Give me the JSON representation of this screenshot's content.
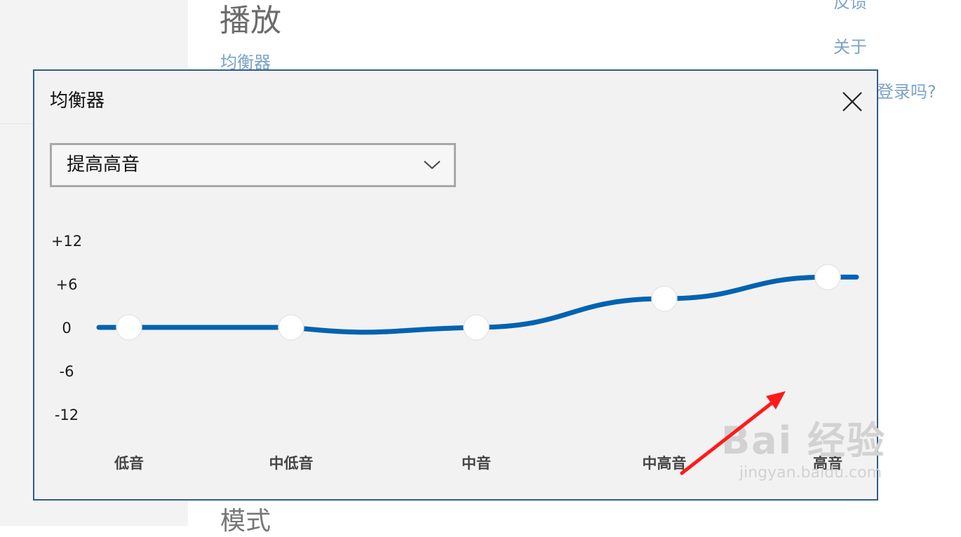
{
  "background": {
    "playback_heading": "播放",
    "equalizer_link": "均衡器",
    "mode_heading": "模式",
    "right_links": {
      "feedback": "反馈",
      "about": "关于",
      "login_prompt": "登录吗?"
    }
  },
  "dialog": {
    "title": "均衡器",
    "preset": {
      "selected": "提高高音"
    },
    "y_axis_labels": [
      "+12",
      "+6",
      "0",
      "-6",
      "-12"
    ],
    "bands": [
      {
        "label": "低音",
        "gain_db": 0
      },
      {
        "label": "中低音",
        "gain_db": 0
      },
      {
        "label": "中音",
        "gain_db": 0
      },
      {
        "label": "中高音",
        "gain_db": 4
      },
      {
        "label": "高音",
        "gain_db": 7
      }
    ],
    "accent_color": "#0063b1"
  },
  "watermark": {
    "logo": "Bai 经验",
    "url": "jingyan.baidu.com"
  },
  "annotation": {
    "arrow_color": "#ff1a1a"
  }
}
